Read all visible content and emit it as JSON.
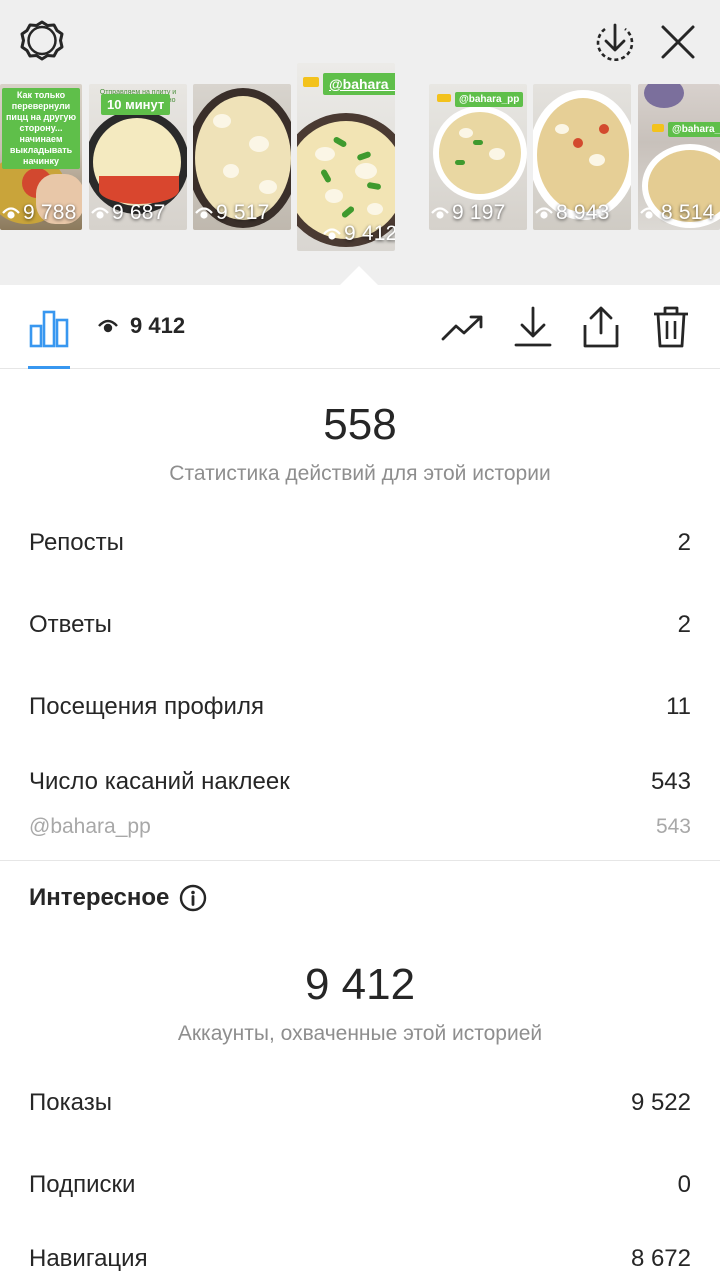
{
  "header": {
    "settings_icon": "settings-gear-icon",
    "save_icon": "download-circle-icon",
    "close_icon": "close-icon"
  },
  "stories": [
    {
      "views": "9 788",
      "caption": "Как только перевернули пицц на другую сторону... начинаем выкладывать начинку"
    },
    {
      "views": "9 687",
      "caption": "10 минут",
      "caption_small": "Отправляем на плиту и готовим ещё примерно"
    },
    {
      "views": "9 517"
    },
    {
      "views": "9 412",
      "caption": "@bahara_pp",
      "selected": true
    },
    {
      "views": "9 197",
      "caption": "@bahara_pp"
    },
    {
      "views": "8 943"
    },
    {
      "views": "8 514",
      "caption": "@bahara_pp"
    }
  ],
  "toolbar": {
    "views_count": "9 412",
    "icons": [
      "bar-chart-icon",
      "eye-icon",
      "trending-icon",
      "download-icon",
      "share-icon",
      "trash-icon"
    ]
  },
  "interactions": {
    "total": "558",
    "subtitle": "Статистика действий для этой истории",
    "rows": [
      {
        "label": "Репосты",
        "value": "2"
      },
      {
        "label": "Ответы",
        "value": "2"
      },
      {
        "label": "Посещения профиля",
        "value": "11"
      },
      {
        "label": "Число касаний наклеек",
        "value": "543"
      }
    ],
    "sticker": {
      "label": "@bahara_pp",
      "value": "543"
    }
  },
  "discovery": {
    "title": "Интересное",
    "total": "9 412",
    "subtitle": "Аккаунты, охваченные этой историей",
    "rows": [
      {
        "label": "Показы",
        "value": "9 522"
      },
      {
        "label": "Подписки",
        "value": "0"
      },
      {
        "label": "Навигация",
        "value": "8 672"
      }
    ]
  },
  "colors": {
    "accent": "#3897f0",
    "sticker_green": "#5fbf4a",
    "secondary_text": "#8e8e8e"
  }
}
